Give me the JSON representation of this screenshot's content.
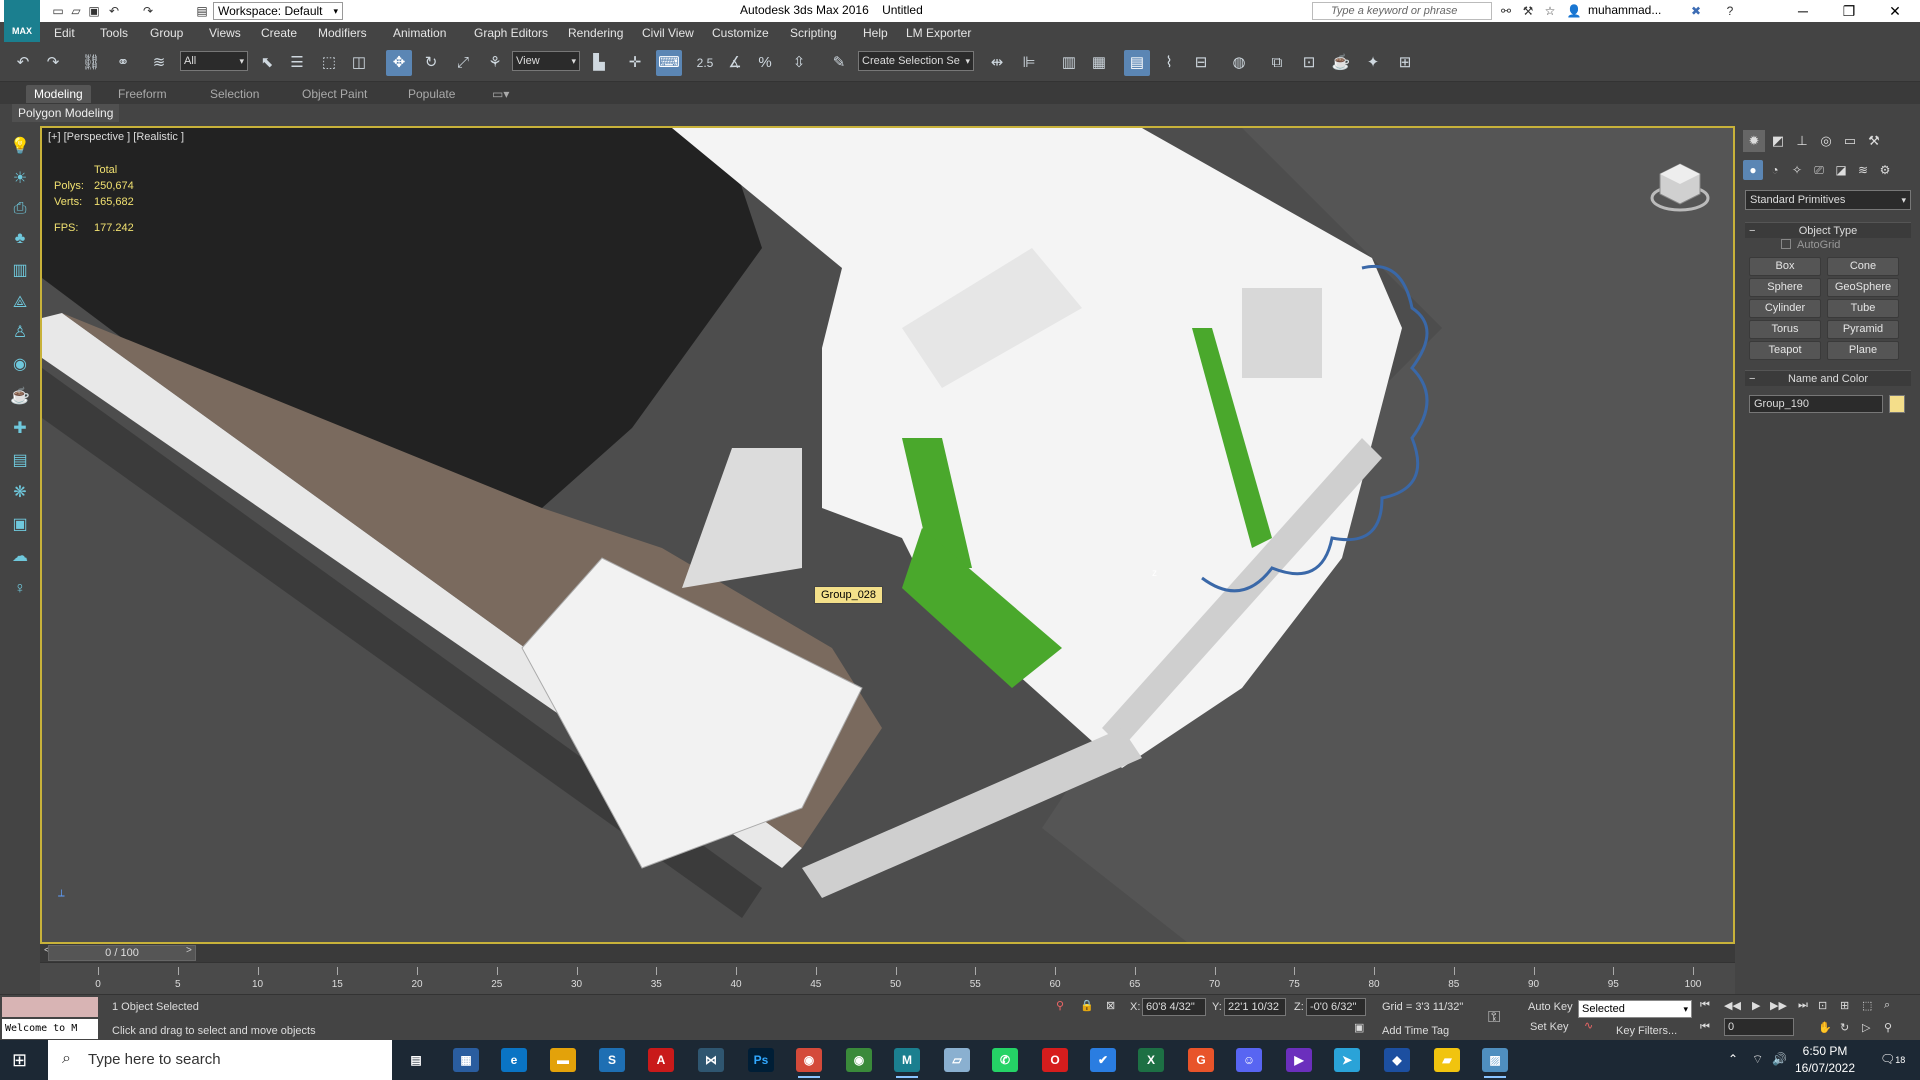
{
  "app": {
    "logo": "MAX",
    "title": "Autodesk 3ds Max 2016",
    "document": "Untitled",
    "workspace": "Workspace: Default",
    "search_placeholder": "Type a keyword or phrase",
    "user": "muhammad..."
  },
  "menu": [
    "Edit",
    "Tools",
    "Group",
    "Views",
    "Create",
    "Modifiers",
    "Animation",
    "Graph Editors",
    "Rendering",
    "Civil View",
    "Customize",
    "Scripting",
    "Help",
    "LM Exporter"
  ],
  "toolbar": {
    "filter": "All",
    "coord_system": "View",
    "snap_label": "2.5",
    "named_selection": "Create Selection Se"
  },
  "ribbon": {
    "tabs": [
      "Modeling",
      "Freeform",
      "Selection",
      "Object Paint",
      "Populate"
    ],
    "active": "Modeling",
    "panel": "Polygon Modeling"
  },
  "viewport": {
    "label": "[+] [Perspective ] [Realistic ]",
    "stats": {
      "header": "Total",
      "polys_label": "Polys:",
      "polys": "250,674",
      "verts_label": "Verts:",
      "verts": "165,682",
      "fps_label": "FPS:",
      "fps": "177.242"
    },
    "object_label": "Group_028",
    "gizmo_axis": "z"
  },
  "command_panel": {
    "dropdown": "Standard Primitives",
    "object_type_title": "Object Type",
    "autogrid": "AutoGrid",
    "buttons": [
      "Box",
      "Cone",
      "Sphere",
      "GeoSphere",
      "Cylinder",
      "Tube",
      "Torus",
      "Pyramid",
      "Teapot",
      "Plane"
    ],
    "name_color_title": "Name and Color",
    "name_value": "Group_190",
    "swatch_color": "#f4de8a"
  },
  "timeline": {
    "frame": "0 / 100",
    "prev": "<",
    "next": ">",
    "ticks": [
      "0",
      "5",
      "10",
      "15",
      "20",
      "25",
      "30",
      "35",
      "40",
      "45",
      "50",
      "55",
      "60",
      "65",
      "70",
      "75",
      "80",
      "85",
      "90",
      "95",
      "100"
    ]
  },
  "status": {
    "listener": "Welcome to M",
    "selected": "1 Object Selected",
    "prompt": "Click and drag to select and move objects",
    "x_label": "X:",
    "x": "60'8 4/32\"",
    "y_label": "Y:",
    "y": "22'1 10/32",
    "z_label": "Z:",
    "z": "-0'0 6/32\"",
    "grid": "Grid = 3'3 11/32\"",
    "add_time_tag": "Add Time Tag",
    "auto_key": "Auto Key",
    "set_key": "Set Key",
    "selected_mode": "Selected",
    "key_filters": "Key Filters...",
    "current_frame": "0"
  },
  "taskbar": {
    "search": "Type here to search",
    "time": "6:50 PM",
    "date": "16/07/2022",
    "notifications": "18"
  }
}
